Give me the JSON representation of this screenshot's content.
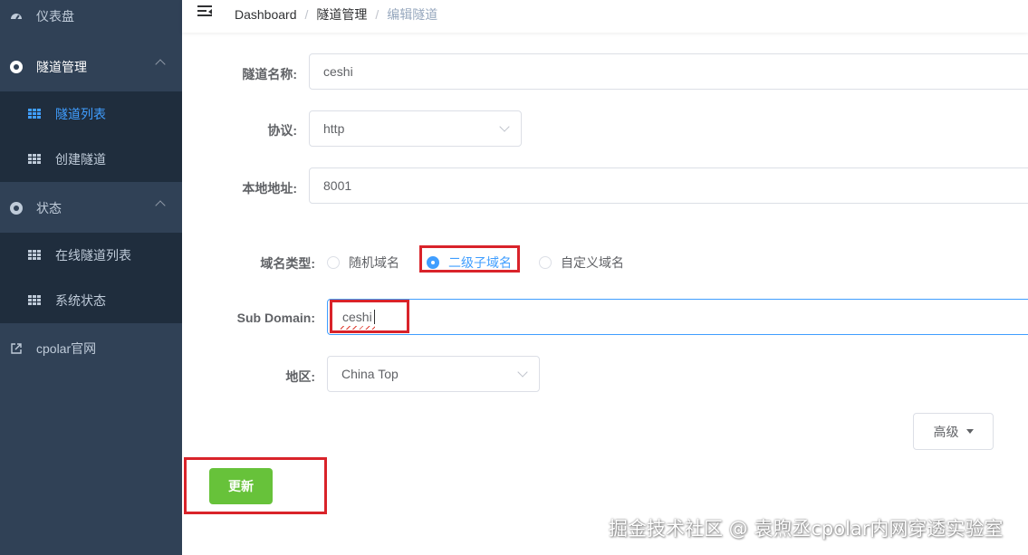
{
  "sidebar": {
    "dashboard": "仪表盘",
    "tunnel_mgmt": "隧道管理",
    "tunnel_list": "隧道列表",
    "create_tunnel": "创建隧道",
    "status": "状态",
    "online_tunnels": "在线隧道列表",
    "system_status": "系统状态",
    "website": "cpolar官网"
  },
  "breadcrumb": {
    "home": "Dashboard",
    "section": "隧道管理",
    "current": "编辑隧道",
    "separator": "/"
  },
  "form": {
    "name_label": "隧道名称:",
    "name_value": "ceshi",
    "protocol_label": "协议:",
    "protocol_value": "http",
    "local_label": "本地地址:",
    "local_value": "8001",
    "domain_type_label": "域名类型:",
    "domain_types": [
      "随机域名",
      "二级子域名",
      "自定义域名"
    ],
    "domain_type_selected": "二级子域名",
    "subdomain_label": "Sub Domain:",
    "subdomain_value": "ceshi",
    "region_label": "地区:",
    "region_value": "China Top",
    "advanced_button": "高级",
    "update_button": "更新"
  },
  "watermark": "掘金技术社区 @ 袁煦丞cpolar内网穿透实验室",
  "colors": {
    "sidebar_bg": "#304156",
    "submenu_bg": "#1f2d3d",
    "active": "#409eff",
    "update_btn": "#67c23a",
    "highlight": "#d9232a"
  }
}
